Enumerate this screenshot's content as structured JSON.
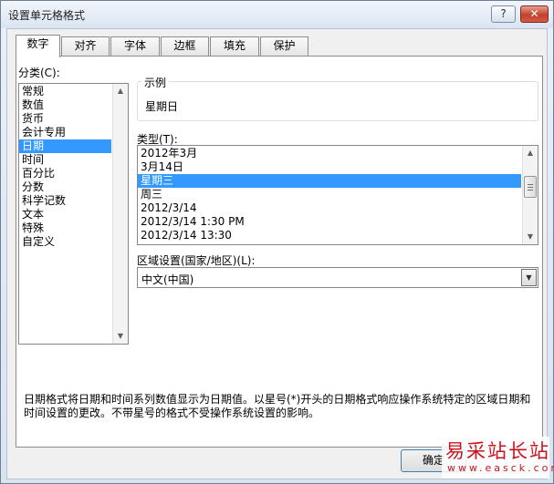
{
  "window": {
    "title": "设置单元格格式",
    "help_label": "?",
    "close_label": "✕"
  },
  "tabs": [
    {
      "label": "数字",
      "active": true
    },
    {
      "label": "对齐"
    },
    {
      "label": "字体"
    },
    {
      "label": "边框"
    },
    {
      "label": "填充"
    },
    {
      "label": "保护"
    }
  ],
  "category": {
    "label": "分类(C):",
    "items": [
      "常规",
      "数值",
      "货币",
      "会计专用",
      "日期",
      "时间",
      "百分比",
      "分数",
      "科学记数",
      "文本",
      "特殊",
      "自定义"
    ],
    "selected": "日期"
  },
  "sample": {
    "label": "示例",
    "value": "星期日"
  },
  "type": {
    "label": "类型(T):",
    "items": [
      "2012年3月",
      "3月14日",
      "星期三",
      "周三",
      "2012/3/14",
      "2012/3/14 1:30 PM",
      "2012/3/14 13:30"
    ],
    "selected": "星期三"
  },
  "locale": {
    "label": "区域设置(国家/地区)(L):",
    "value": "中文(中国)"
  },
  "description": "日期格式将日期和时间系列数值显示为日期值。以星号(*)开头的日期格式响应操作系统特定的区域日期和时间设置的更改。不带星号的格式不受操作系统设置的影响。",
  "buttons": {
    "ok_label": "确定"
  },
  "watermark": {
    "main": "易采站长站",
    "sub": "www.easck.com"
  },
  "colors": {
    "selection": "#3399ff",
    "watermark": "#c9141e"
  }
}
